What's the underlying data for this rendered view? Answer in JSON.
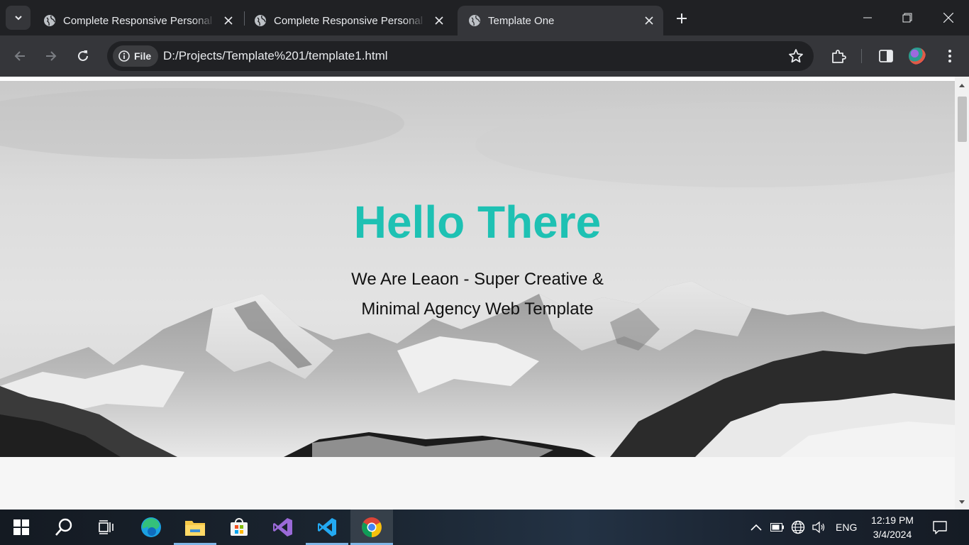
{
  "browser": {
    "tabs": [
      {
        "title": "Complete Responsive Personal Portfolio Website",
        "active": false,
        "favicon": "globe-icon"
      },
      {
        "title": "Complete Responsive Personal Portfolio Website",
        "active": false,
        "favicon": "globe-icon"
      },
      {
        "title": "Template One",
        "active": true,
        "favicon": "globe-icon"
      }
    ],
    "chip_label": "File",
    "url": "D:/Projects/Template%201/template1.html"
  },
  "page": {
    "hero_title": "Hello There",
    "hero_subtitle_line1": "We Are Leaon - Super Creative &",
    "hero_subtitle_line2": "Minimal Agency Web Template",
    "accent_color": "#1ec1b3"
  },
  "taskbar": {
    "apps": [
      "start-icon",
      "search-icon",
      "task-view-icon",
      "edge-icon",
      "file-explorer-icon",
      "microsoft-store-icon",
      "visual-studio-icon",
      "vscode-icon",
      "chrome-icon"
    ],
    "language": "ENG",
    "time": "12:19 PM",
    "date": "3/4/2024"
  }
}
